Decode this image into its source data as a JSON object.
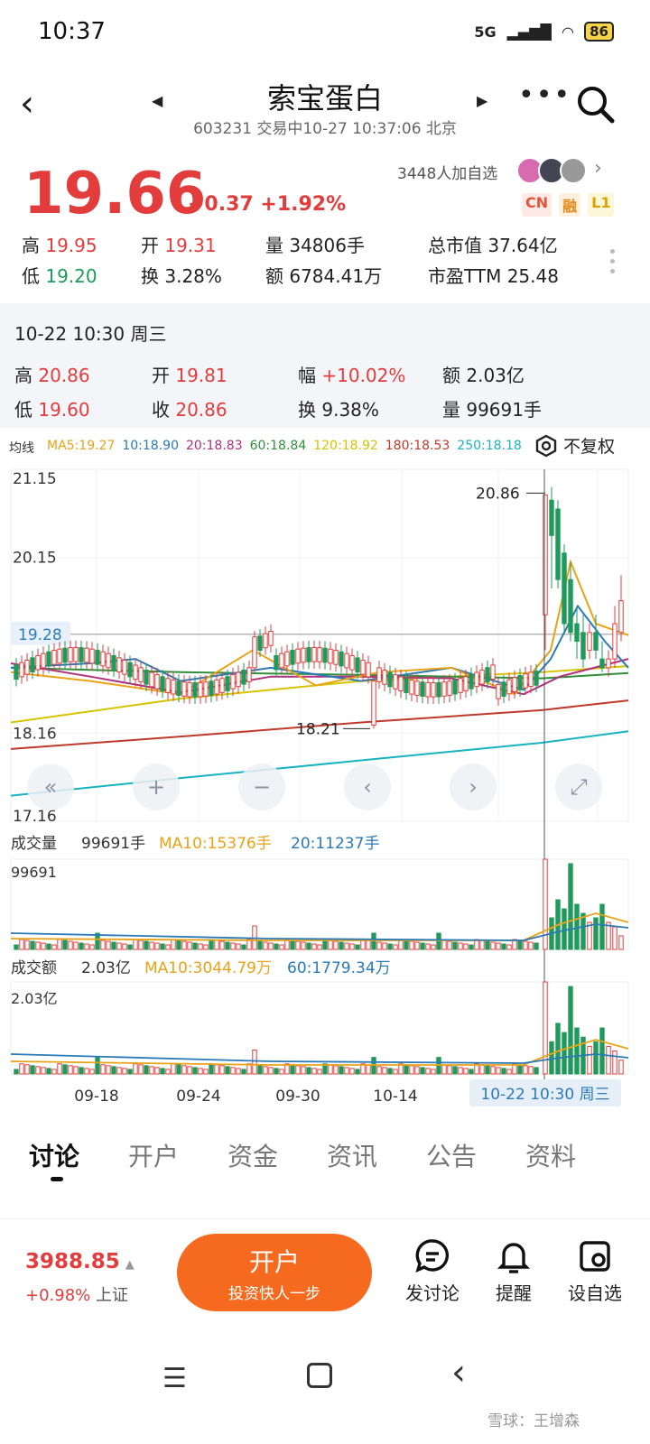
{
  "status": {
    "time": "10:37",
    "network": "5G",
    "battery": "86"
  },
  "header": {
    "name": "索宝蛋白",
    "subtitle": "603231 交易中10-27 10:37:06 北京"
  },
  "quote": {
    "price": "19.66",
    "change": "+0.37",
    "change_pct": "+1.92%",
    "followers": "3448人加自选",
    "tags": [
      "CN",
      "融",
      "L1"
    ],
    "stats": [
      {
        "label": "高",
        "value": "19.95",
        "color": "red"
      },
      {
        "label": "开",
        "value": "19.31",
        "color": "red"
      },
      {
        "label": "量",
        "value": "34806手",
        "color": ""
      },
      {
        "label": "总市值",
        "value": "37.64亿",
        "color": ""
      },
      {
        "label": "低",
        "value": "19.20",
        "color": "green"
      },
      {
        "label": "换",
        "value": "3.28%",
        "color": ""
      },
      {
        "label": "额",
        "value": "6784.41万",
        "color": ""
      },
      {
        "label": "市盈TTM",
        "value": "25.48",
        "color": ""
      }
    ]
  },
  "history": {
    "date": "10-22 10:30 周三",
    "stats": [
      {
        "label": "高",
        "value": "20.86",
        "color": "red"
      },
      {
        "label": "开",
        "value": "19.81",
        "color": "red"
      },
      {
        "label": "幅",
        "value": "+10.02%",
        "color": "red"
      },
      {
        "label": "额",
        "value": "2.03亿",
        "color": ""
      },
      {
        "label": "低",
        "value": "19.60",
        "color": "red"
      },
      {
        "label": "收",
        "value": "20.86",
        "color": "red"
      },
      {
        "label": "换",
        "value": "9.38%",
        "color": ""
      },
      {
        "label": "量",
        "value": "99691手",
        "color": ""
      }
    ]
  },
  "ma_legend": {
    "title": "均线",
    "items": [
      {
        "text": "MA5:19.27",
        "color": "#e8a317"
      },
      {
        "text": "10:18.90",
        "color": "#2a7ab8"
      },
      {
        "text": "20:18.83",
        "color": "#b0307f"
      },
      {
        "text": "60:18.84",
        "color": "#2f8f3a"
      },
      {
        "text": "120:18.92",
        "color": "#d6c400"
      },
      {
        "text": "180:18.53",
        "color": "#c0392b"
      },
      {
        "text": "250:18.18",
        "color": "#17b3c0"
      }
    ],
    "adjust": "不复权"
  },
  "chart_data": {
    "type": "candlestick",
    "price_axis": [
      "21.15",
      "20.15",
      "19.28",
      "18.16",
      "17.16"
    ],
    "ylim": [
      17.16,
      21.15
    ],
    "current_line": "19.28",
    "high_label": "20.86",
    "low_label": "18.21",
    "x_ticks": [
      "09-18",
      "09-24",
      "09-30",
      "10-14"
    ],
    "selected": "10-22 10:30 周三",
    "volume": {
      "title": "成交量",
      "value": "99691手",
      "ma10": "MA10:15376手",
      "ma20": "20:11237手",
      "max": "99691"
    },
    "amount": {
      "title": "成交额",
      "value": "2.03亿",
      "ma10": "MA10:3044.79万",
      "ma60": "60:1779.34万",
      "max": "2.03亿"
    }
  },
  "chart_controls": [
    "«",
    "+",
    "−",
    "‹",
    "›",
    "⤢"
  ],
  "tabs": [
    "讨论",
    "开户",
    "资金",
    "资讯",
    "公告",
    "资料"
  ],
  "bottom": {
    "index_value": "3988.85",
    "index_change": "+0.98%",
    "index_name": "上证",
    "open_title": "开户",
    "open_sub": "投资快人一步",
    "actions": [
      "发讨论",
      "提醒",
      "设自选"
    ]
  },
  "watermark": "雪球：王增森",
  "colors": {
    "up": "#e23c3c",
    "down": "#1e9b5a",
    "accent": "#f56a1f"
  }
}
